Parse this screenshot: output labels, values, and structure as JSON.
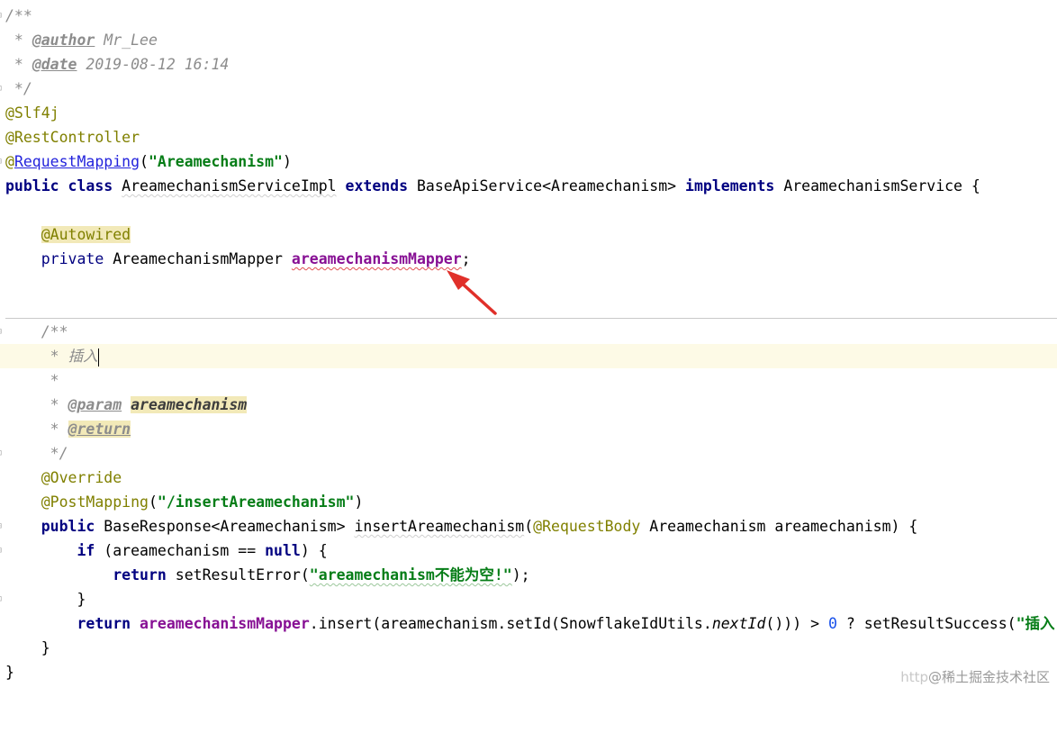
{
  "editor": {
    "javadoc_top": {
      "open": "/**",
      "author_tag": "@author",
      "author_value": " Mr_Lee",
      "date_tag": "@date",
      "date_value": " 2019-08-12 16:14",
      "close": " */"
    },
    "annotations": {
      "slf4j": "@Slf4j",
      "rest_controller": "@RestController",
      "at": "@",
      "request_mapping": "RequestMapping",
      "request_mapping_value": "\"Areamechanism\""
    },
    "class_decl": {
      "public": "public",
      "class": "class",
      "name": "AreamechanismServiceImpl",
      "extends": "extends",
      "base": "BaseApiService<Areamechanism>",
      "implements": "implements",
      "iface": "AreamechanismService {"
    },
    "field": {
      "annotation": "@Autowired",
      "private": "private",
      "type": "AreamechanismMapper",
      "name": "areamechanismMapper"
    },
    "method_doc": {
      "open": "/**",
      "line1_prefix": " * ",
      "line1_text": "插入",
      "blank": " *",
      "param_tag": "@param",
      "param_name": "areamechanism",
      "return_tag": "@return",
      "close": " */"
    },
    "method": {
      "override": "@Override",
      "post_mapping": "@PostMapping",
      "post_mapping_value": "\"/insertAreamechanism\"",
      "public": "public",
      "return_type": "BaseResponse<Areamechanism>",
      "name": "insertAreamechanism",
      "request_body": "@RequestBody",
      "param_decl": "Areamechanism areamechanism) {",
      "if": "if",
      "cond": "(areamechanism == ",
      "null": "null",
      "cond_end": ") {",
      "return": "return",
      "set_error": "setResultError(",
      "error_msg": "\"areamechanism不能为空!\"",
      "set_error_end": ");",
      "close_if": "}",
      "return2": "return",
      "mapper_ref": "areamechanismMapper",
      "insert_call": ".insert(areamechanism.setId(SnowflakeIdUtils.",
      "next_id": "nextId",
      "insert_end": "())) > ",
      "zero": "0",
      "ternary": " ? setResultSuccess(",
      "success_msg": "\"插入",
      "close_method": "}",
      "close_class": "}"
    }
  },
  "watermark": {
    "prefix": "http",
    "brand": "@稀土掘金技术社区"
  },
  "colors": {
    "keyword": "#000080",
    "string": "#067d17",
    "annotation": "#808000",
    "comment": "#8c8c8c",
    "field": "#871094",
    "arrow": "#e0302a"
  }
}
